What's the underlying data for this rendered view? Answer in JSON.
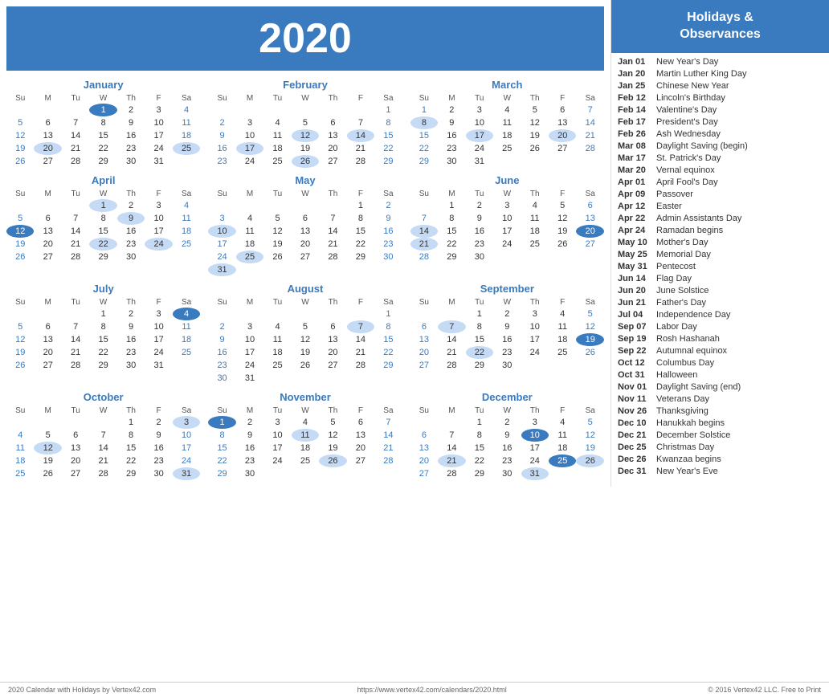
{
  "year": "2020",
  "sidebar_header": "Holidays &\nObservances",
  "footer_left": "2020 Calendar with Holidays by Vertex42.com",
  "footer_center": "https://www.vertex42.com/calendars/2020.html",
  "footer_right": "© 2016 Vertex42 LLC. Free to Print",
  "months": [
    {
      "name": "January",
      "days_header": [
        "Su",
        "M",
        "Tu",
        "W",
        "Th",
        "F",
        "Sa"
      ],
      "weeks": [
        [
          "",
          "",
          "",
          "1",
          "2",
          "3",
          "4"
        ],
        [
          "5",
          "6",
          "7",
          "8",
          "9",
          "10",
          "11"
        ],
        [
          "12",
          "13",
          "14",
          "15",
          "16",
          "17",
          "18"
        ],
        [
          "19",
          "20",
          "21",
          "22",
          "23",
          "24",
          "25"
        ],
        [
          "26",
          "27",
          "28",
          "29",
          "30",
          "31",
          ""
        ]
      ],
      "highlights_blue": [
        "1"
      ],
      "highlights_light": [
        "20",
        "25"
      ]
    },
    {
      "name": "February",
      "days_header": [
        "Su",
        "M",
        "Tu",
        "W",
        "Th",
        "F",
        "Sa"
      ],
      "weeks": [
        [
          "",
          "",
          "",
          "",
          "",
          "",
          "1"
        ],
        [
          "2",
          "3",
          "4",
          "5",
          "6",
          "7",
          "8"
        ],
        [
          "9",
          "10",
          "11",
          "12",
          "13",
          "14",
          "15"
        ],
        [
          "16",
          "17",
          "18",
          "19",
          "20",
          "21",
          "22"
        ],
        [
          "23",
          "24",
          "25",
          "26",
          "27",
          "28",
          "29"
        ]
      ],
      "highlights_blue": [],
      "highlights_light": [
        "12",
        "14",
        "17",
        "26"
      ]
    },
    {
      "name": "March",
      "days_header": [
        "Su",
        "M",
        "Tu",
        "W",
        "Th",
        "F",
        "Sa"
      ],
      "weeks": [
        [
          "1",
          "2",
          "3",
          "4",
          "5",
          "6",
          "7"
        ],
        [
          "8",
          "9",
          "10",
          "11",
          "12",
          "13",
          "14"
        ],
        [
          "15",
          "16",
          "17",
          "18",
          "19",
          "20",
          "21"
        ],
        [
          "22",
          "23",
          "24",
          "25",
          "26",
          "27",
          "28"
        ],
        [
          "29",
          "30",
          "31",
          "",
          "",
          "",
          ""
        ]
      ],
      "highlights_blue": [],
      "highlights_light": [
        "8",
        "17",
        "20"
      ]
    },
    {
      "name": "April",
      "days_header": [
        "Su",
        "M",
        "Tu",
        "W",
        "Th",
        "F",
        "Sa"
      ],
      "weeks": [
        [
          "",
          "",
          "",
          "1",
          "2",
          "3",
          "4"
        ],
        [
          "5",
          "6",
          "7",
          "8",
          "9",
          "10",
          "11"
        ],
        [
          "12",
          "13",
          "14",
          "15",
          "16",
          "17",
          "18"
        ],
        [
          "19",
          "20",
          "21",
          "22",
          "23",
          "24",
          "25"
        ],
        [
          "26",
          "27",
          "28",
          "29",
          "30",
          "",
          ""
        ]
      ],
      "highlights_blue": [
        "12"
      ],
      "highlights_light": [
        "1",
        "9",
        "22",
        "24"
      ]
    },
    {
      "name": "May",
      "days_header": [
        "Su",
        "M",
        "Tu",
        "W",
        "Th",
        "F",
        "Sa"
      ],
      "weeks": [
        [
          "",
          "",
          "",
          "",
          "",
          "1",
          "2"
        ],
        [
          "3",
          "4",
          "5",
          "6",
          "7",
          "8",
          "9"
        ],
        [
          "10",
          "11",
          "12",
          "13",
          "14",
          "15",
          "16"
        ],
        [
          "17",
          "18",
          "19",
          "20",
          "21",
          "22",
          "23"
        ],
        [
          "24",
          "25",
          "26",
          "27",
          "28",
          "29",
          "30"
        ],
        [
          "31",
          "",
          "",
          "",
          "",
          "",
          ""
        ]
      ],
      "highlights_blue": [],
      "highlights_light": [
        "10",
        "25",
        "31"
      ]
    },
    {
      "name": "June",
      "days_header": [
        "Su",
        "M",
        "Tu",
        "W",
        "Th",
        "F",
        "Sa"
      ],
      "weeks": [
        [
          "",
          "1",
          "2",
          "3",
          "4",
          "5",
          "6"
        ],
        [
          "7",
          "8",
          "9",
          "10",
          "11",
          "12",
          "13"
        ],
        [
          "14",
          "15",
          "16",
          "17",
          "18",
          "19",
          "20"
        ],
        [
          "21",
          "22",
          "23",
          "24",
          "25",
          "26",
          "27"
        ],
        [
          "28",
          "29",
          "30",
          "",
          "",
          "",
          ""
        ]
      ],
      "highlights_blue": [
        "20"
      ],
      "highlights_light": [
        "14",
        "21"
      ]
    },
    {
      "name": "July",
      "days_header": [
        "Su",
        "M",
        "Tu",
        "W",
        "Th",
        "F",
        "Sa"
      ],
      "weeks": [
        [
          "",
          "",
          "",
          "1",
          "2",
          "3",
          "4"
        ],
        [
          "5",
          "6",
          "7",
          "8",
          "9",
          "10",
          "11"
        ],
        [
          "12",
          "13",
          "14",
          "15",
          "16",
          "17",
          "18"
        ],
        [
          "19",
          "20",
          "21",
          "22",
          "23",
          "24",
          "25"
        ],
        [
          "26",
          "27",
          "28",
          "29",
          "30",
          "31",
          ""
        ]
      ],
      "highlights_blue": [
        "4"
      ],
      "highlights_light": []
    },
    {
      "name": "August",
      "days_header": [
        "Su",
        "M",
        "Tu",
        "W",
        "Th",
        "F",
        "Sa"
      ],
      "weeks": [
        [
          "",
          "",
          "",
          "",
          "",
          "",
          "1"
        ],
        [
          "2",
          "3",
          "4",
          "5",
          "6",
          "7",
          "8"
        ],
        [
          "9",
          "10",
          "11",
          "12",
          "13",
          "14",
          "15"
        ],
        [
          "16",
          "17",
          "18",
          "19",
          "20",
          "21",
          "22"
        ],
        [
          "23",
          "24",
          "25",
          "26",
          "27",
          "28",
          "29"
        ],
        [
          "30",
          "31",
          "",
          "",
          "",
          "",
          ""
        ]
      ],
      "highlights_blue": [],
      "highlights_light": [
        "7"
      ]
    },
    {
      "name": "September",
      "days_header": [
        "Su",
        "M",
        "Tu",
        "W",
        "Th",
        "F",
        "Sa"
      ],
      "weeks": [
        [
          "",
          "",
          "1",
          "2",
          "3",
          "4",
          "5"
        ],
        [
          "6",
          "7",
          "8",
          "9",
          "10",
          "11",
          "12"
        ],
        [
          "13",
          "14",
          "15",
          "16",
          "17",
          "18",
          "19"
        ],
        [
          "20",
          "21",
          "22",
          "23",
          "24",
          "25",
          "26"
        ],
        [
          "27",
          "28",
          "29",
          "30",
          "",
          "",
          ""
        ]
      ],
      "highlights_blue": [
        "19"
      ],
      "highlights_light": [
        "7",
        "22"
      ]
    },
    {
      "name": "October",
      "days_header": [
        "Su",
        "M",
        "Tu",
        "W",
        "Th",
        "F",
        "Sa"
      ],
      "weeks": [
        [
          "",
          "",
          "",
          "",
          "1",
          "2",
          "3"
        ],
        [
          "4",
          "5",
          "6",
          "7",
          "8",
          "9",
          "10"
        ],
        [
          "11",
          "12",
          "13",
          "14",
          "15",
          "16",
          "17"
        ],
        [
          "18",
          "19",
          "20",
          "21",
          "22",
          "23",
          "24"
        ],
        [
          "25",
          "26",
          "27",
          "28",
          "29",
          "30",
          "31"
        ]
      ],
      "highlights_blue": [],
      "highlights_light": [
        "3",
        "12",
        "31"
      ]
    },
    {
      "name": "November",
      "days_header": [
        "Su",
        "M",
        "Tu",
        "W",
        "Th",
        "F",
        "Sa"
      ],
      "weeks": [
        [
          "1",
          "2",
          "3",
          "4",
          "5",
          "6",
          "7"
        ],
        [
          "8",
          "9",
          "10",
          "11",
          "12",
          "13",
          "14"
        ],
        [
          "15",
          "16",
          "17",
          "18",
          "19",
          "20",
          "21"
        ],
        [
          "22",
          "23",
          "24",
          "25",
          "26",
          "27",
          "28"
        ],
        [
          "29",
          "30",
          "",
          "",
          "",
          "",
          ""
        ]
      ],
      "highlights_blue": [
        "1"
      ],
      "highlights_light": [
        "11",
        "26"
      ]
    },
    {
      "name": "December",
      "days_header": [
        "Su",
        "M",
        "Tu",
        "W",
        "Th",
        "F",
        "Sa"
      ],
      "weeks": [
        [
          "",
          "",
          "1",
          "2",
          "3",
          "4",
          "5"
        ],
        [
          "6",
          "7",
          "8",
          "9",
          "10",
          "11",
          "12"
        ],
        [
          "13",
          "14",
          "15",
          "16",
          "17",
          "18",
          "19"
        ],
        [
          "20",
          "21",
          "22",
          "23",
          "24",
          "25",
          "26"
        ],
        [
          "27",
          "28",
          "29",
          "30",
          "31",
          "",
          ""
        ]
      ],
      "highlights_blue": [
        "10",
        "25"
      ],
      "highlights_light": [
        "21",
        "26",
        "31"
      ]
    }
  ],
  "holidays": [
    {
      "date": "Jan 01",
      "name": "New Year's Day"
    },
    {
      "date": "Jan 20",
      "name": "Martin Luther King Day"
    },
    {
      "date": "Jan 25",
      "name": "Chinese New Year"
    },
    {
      "date": "Feb 12",
      "name": "Lincoln's Birthday"
    },
    {
      "date": "Feb 14",
      "name": "Valentine's Day"
    },
    {
      "date": "Feb 17",
      "name": "President's Day"
    },
    {
      "date": "Feb 26",
      "name": "Ash Wednesday"
    },
    {
      "date": "Mar 08",
      "name": "Daylight Saving (begin)"
    },
    {
      "date": "Mar 17",
      "name": "St. Patrick's Day"
    },
    {
      "date": "Mar 20",
      "name": "Vernal equinox"
    },
    {
      "date": "Apr 01",
      "name": "April Fool's Day"
    },
    {
      "date": "Apr 09",
      "name": "Passover"
    },
    {
      "date": "Apr 12",
      "name": "Easter"
    },
    {
      "date": "Apr 22",
      "name": "Admin Assistants Day"
    },
    {
      "date": "Apr 24",
      "name": "Ramadan begins"
    },
    {
      "date": "May 10",
      "name": "Mother's Day"
    },
    {
      "date": "May 25",
      "name": "Memorial Day"
    },
    {
      "date": "May 31",
      "name": "Pentecost"
    },
    {
      "date": "Jun 14",
      "name": "Flag Day"
    },
    {
      "date": "Jun 20",
      "name": "June Solstice"
    },
    {
      "date": "Jun 21",
      "name": "Father's Day"
    },
    {
      "date": "Jul 04",
      "name": "Independence Day"
    },
    {
      "date": "Sep 07",
      "name": "Labor Day"
    },
    {
      "date": "Sep 19",
      "name": "Rosh Hashanah"
    },
    {
      "date": "Sep 22",
      "name": "Autumnal equinox"
    },
    {
      "date": "Oct 12",
      "name": "Columbus Day"
    },
    {
      "date": "Oct 31",
      "name": "Halloween"
    },
    {
      "date": "Nov 01",
      "name": "Daylight Saving (end)"
    },
    {
      "date": "Nov 11",
      "name": "Veterans Day"
    },
    {
      "date": "Nov 26",
      "name": "Thanksgiving"
    },
    {
      "date": "Dec 10",
      "name": "Hanukkah begins"
    },
    {
      "date": "Dec 21",
      "name": "December Solstice"
    },
    {
      "date": "Dec 25",
      "name": "Christmas Day"
    },
    {
      "date": "Dec 26",
      "name": "Kwanzaa begins"
    },
    {
      "date": "Dec 31",
      "name": "New Year's Eve"
    }
  ]
}
